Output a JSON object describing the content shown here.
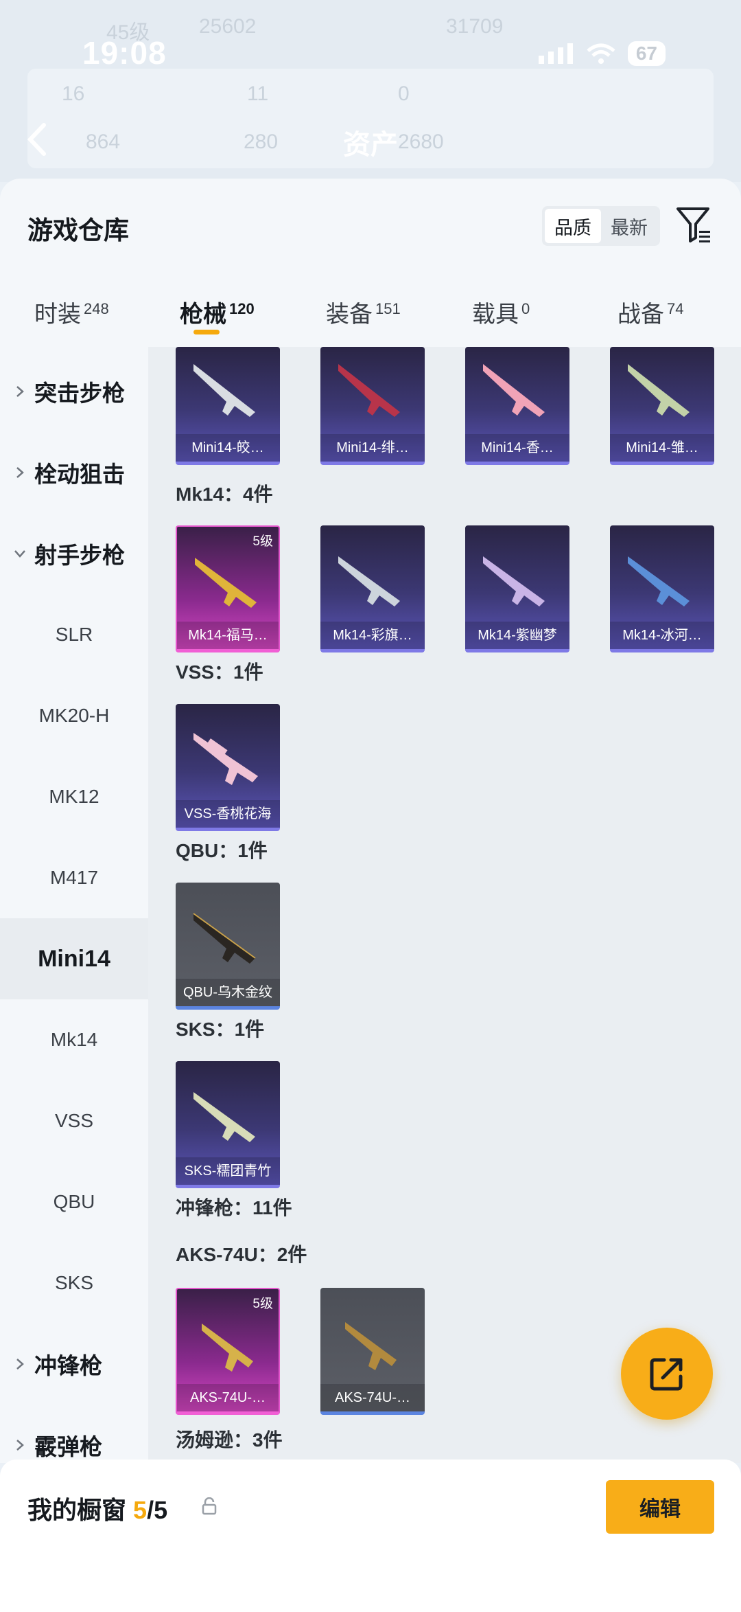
{
  "status_bar": {
    "time": "19:08",
    "battery": "67"
  },
  "header": {
    "level": "45级",
    "coins": "25602",
    "points": "31709",
    "stat1": "16",
    "stat2": "11",
    "stat3": "0",
    "stat4": "864",
    "stat5": "280",
    "title": "资产",
    "title_value": "2680"
  },
  "sheet": {
    "title": "游戏仓库",
    "sort_options": [
      "品质",
      "最新"
    ],
    "active_sort": "品质"
  },
  "tabs": [
    {
      "label": "时装",
      "count": "248"
    },
    {
      "label": "枪械",
      "count": "120"
    },
    {
      "label": "装备",
      "count": "151"
    },
    {
      "label": "载具",
      "count": "0"
    },
    {
      "label": "战备",
      "count": "74"
    }
  ],
  "sidebar": [
    {
      "label": "突击步枪",
      "type": "group"
    },
    {
      "label": "栓动狙击",
      "type": "group"
    },
    {
      "label": "射手步枪",
      "type": "group-open"
    },
    {
      "label": "SLR"
    },
    {
      "label": "MK20-H"
    },
    {
      "label": "MK12"
    },
    {
      "label": "M417"
    },
    {
      "label": "Mini14",
      "active": true
    },
    {
      "label": "Mk14"
    },
    {
      "label": "VSS"
    },
    {
      "label": "QBU"
    },
    {
      "label": "SKS"
    },
    {
      "label": "冲锋枪",
      "type": "group"
    },
    {
      "label": "霰弹枪",
      "type": "group"
    }
  ],
  "sections": {
    "mini14_items": [
      "Mini14-皎…",
      "Mini14-绯…",
      "Mini14-香…",
      "Mini14-雏…"
    ],
    "mk14_header": "Mk14：4件",
    "mk14_items": [
      "Mk14-福马…",
      "Mk14-彩旗…",
      "Mk14-紫幽梦",
      "Mk14-冰河…"
    ],
    "mk14_level": "5级",
    "vss_header": "VSS：1件",
    "vss_items": [
      "VSS-香桃花海"
    ],
    "qbu_header": "QBU：1件",
    "qbu_items": [
      "QBU-乌木金纹"
    ],
    "sks_header": "SKS：1件",
    "sks_items": [
      "SKS-糯团青竹"
    ],
    "smg_header": "冲锋枪：11件",
    "aks_header": "AKS-74U：2件",
    "aks_items": [
      "AKS-74U-…",
      "AKS-74U-…"
    ],
    "aks_level": "5级",
    "thompson_header": "汤姆逊：3件"
  },
  "bottom": {
    "title": "我的橱窗",
    "count_current": "5",
    "count_total": "/5",
    "edit_label": "编辑"
  },
  "colors": {
    "accent": "#f8ad18",
    "purple": "#5b55b8",
    "pink": "#d547c2",
    "grey": "#5c5f67"
  }
}
